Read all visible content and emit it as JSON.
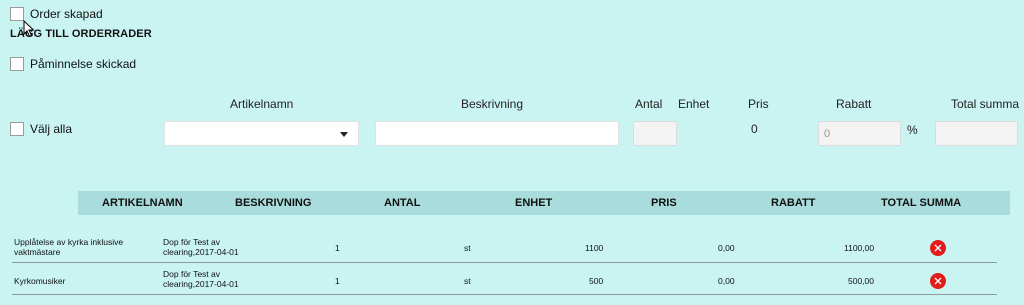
{
  "order_created": {
    "label": "Order skapad"
  },
  "add_rows_title": "LÄGG TILL ORDERRADER",
  "reminder_sent": {
    "label": "Påminnelse skickad"
  },
  "select_all": {
    "label": "Välj alla"
  },
  "form": {
    "article_label": "Artikelnamn",
    "description_label": "Beskrivning",
    "quantity_label": "Antal",
    "unit_label": "Enhet",
    "price_label": "Pris",
    "discount_label": "Rabatt",
    "total_label": "Total summa",
    "price_value": "0",
    "discount_value": "0",
    "percent_sign": "%"
  },
  "table": {
    "headers": [
      "ARTIKELNAMN",
      "BESKRIVNING",
      "ANTAL",
      "ENHET",
      "PRIS",
      "RABATT",
      "TOTAL SUMMA"
    ],
    "rows": [
      {
        "article": "Upplåtelse av kyrka inklusive vaktmästare",
        "description": "Dop för Test av clearing,2017-04-01",
        "quantity": "1",
        "unit": "st",
        "price": "1100",
        "discount": "0,00",
        "total": "1100,00"
      },
      {
        "article": "Kyrkomusiker",
        "description": "Dop för Test av clearing,2017-04-01",
        "quantity": "1",
        "unit": "st",
        "price": "500",
        "discount": "0,00",
        "total": "500,00"
      }
    ]
  },
  "colors": {
    "background": "#c9f4f2",
    "header_bar": "#a9dcdc",
    "delete": "#e31b1b"
  },
  "icons": {
    "delete": "close-circle-icon",
    "cursor": "mouse-pointer-icon",
    "dropdown": "chevron-down-icon"
  }
}
